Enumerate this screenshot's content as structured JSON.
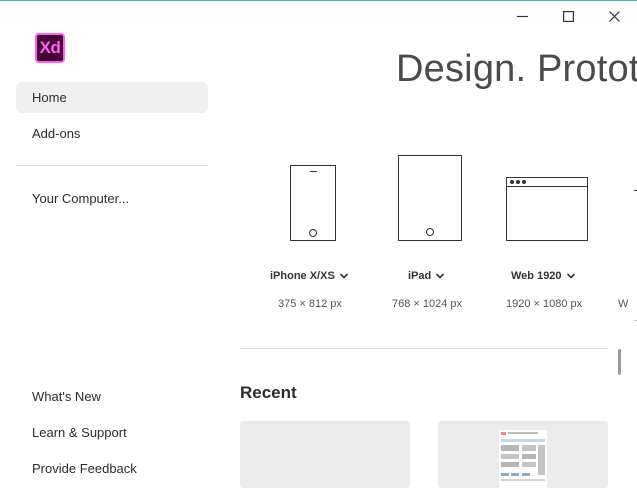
{
  "app": {
    "logo_text": "Xd",
    "brand_color": "#ff61f6",
    "brand_bg": "#470137"
  },
  "window": {
    "minimize_icon": "minimize-icon",
    "maximize_icon": "maximize-icon",
    "close_icon": "close-icon"
  },
  "sidebar": {
    "top_items": [
      {
        "label": "Home",
        "selected": true
      },
      {
        "label": "Add-ons"
      }
    ],
    "computer_item": {
      "label": "Your Computer..."
    },
    "bottom_items": [
      {
        "label": "What's New"
      },
      {
        "label": "Learn & Support"
      },
      {
        "label": "Provide Feedback"
      }
    ]
  },
  "main": {
    "headline": "Design. Prototy",
    "presets": [
      {
        "name": "iPhone X/XS",
        "size": "375 × 812 px",
        "icon": "phone-icon"
      },
      {
        "name": "iPad",
        "size": "768 × 1024 px",
        "icon": "tablet-icon"
      },
      {
        "name": "Web 1920",
        "size": "1920 × 1080 px",
        "icon": "browser-icon"
      },
      {
        "name": "",
        "size": "W",
        "icon": "custom-size-icon"
      }
    ],
    "recent_title": "Recent"
  }
}
